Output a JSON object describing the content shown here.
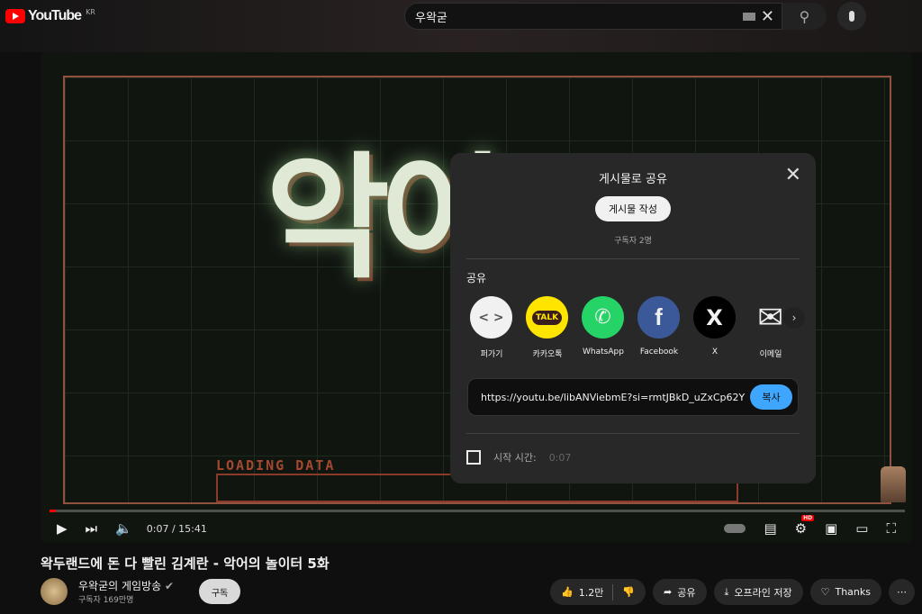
{
  "header": {
    "logo": "YouTube",
    "region": "KR",
    "search_value": "우왁굳"
  },
  "video": {
    "art_text": "악어",
    "overlay_text": "LOADING DATA",
    "current_time": "0:07",
    "duration": "15:41",
    "time_sep": " / ",
    "progress_percent": 0.75,
    "hd_badge": "HD"
  },
  "share_dialog": {
    "title": "게시물로 공유",
    "post_button": "게시물 작성",
    "subscribers": "구독자 2명",
    "share_label": "공유",
    "targets": [
      {
        "label": "퍼가기",
        "icon": "embed-icon",
        "color": "#f1f1f1"
      },
      {
        "label": "카카오톡",
        "icon": "kakaotalk-icon",
        "color": "#fee500"
      },
      {
        "label": "WhatsApp",
        "icon": "whatsapp-icon",
        "color": "#25d366"
      },
      {
        "label": "Facebook",
        "icon": "facebook-icon",
        "color": "#3b5998"
      },
      {
        "label": "X",
        "icon": "x-icon",
        "color": "#000000"
      },
      {
        "label": "이메일",
        "icon": "email-icon",
        "color": "#282828"
      }
    ],
    "kakao_glyph": "TALK",
    "embed_glyph": "< >",
    "fb_glyph": "f",
    "x_glyph": "X",
    "email_glyph": "✉",
    "url": "https://youtu.be/libANViebmE?si=rmtJBkD_uZxCp62Y",
    "copy_button": "복사",
    "start_time_label": "시작 시간:",
    "start_time_value": "0:07"
  },
  "below": {
    "title": "왁두랜드에 돈 다 빨린 김계란 - 악어의 놀이터 5화",
    "channel": "우왁굳의 게임방송",
    "channel_subs": "구독자 169만명",
    "subscribe": "구독",
    "likes": "1.2만",
    "share": "공유",
    "download": "오프라인 저장",
    "thanks": "Thanks"
  }
}
